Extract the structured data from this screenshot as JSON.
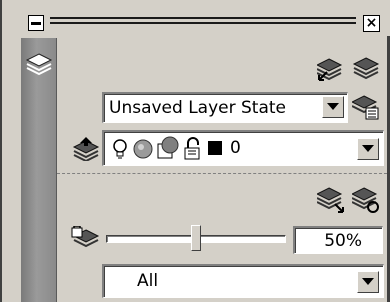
{
  "layer_state": {
    "selected": "Unsaved Layer State"
  },
  "layer_row": {
    "name": "0"
  },
  "isolate": {
    "fade_percent": "50%",
    "fade_level": 0.5
  },
  "filter": {
    "selected": "All"
  },
  "icons": {
    "panel": "layers-panel-icon",
    "match": "layer-match-icon",
    "previous": "layer-previous-icon",
    "state_manager": "layer-state-manager-icon",
    "make_current": "make-object-layer-current-icon",
    "isolate": "layer-isolate-icon",
    "unisolate": "layer-unisolate-icon",
    "lock_fade": "locked-layer-fading-icon"
  }
}
